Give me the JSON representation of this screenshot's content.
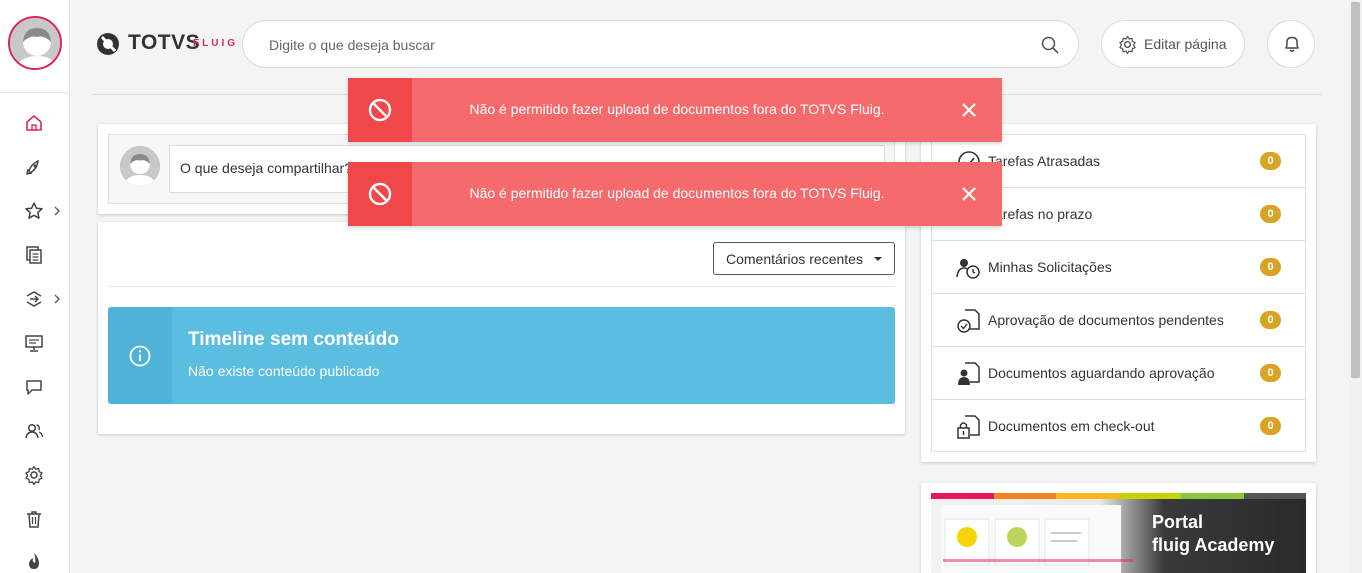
{
  "header": {
    "logo_text": "TOTVS",
    "logo_sub": "FLUIG",
    "search_placeholder": "Digite o que deseja buscar",
    "edit_label": "Editar página"
  },
  "sidebar": {
    "items": [
      {
        "name": "home-icon"
      },
      {
        "name": "rocket-icon"
      },
      {
        "name": "star-icon"
      },
      {
        "name": "documents-icon"
      },
      {
        "name": "workflow-icon"
      },
      {
        "name": "presentation-icon"
      },
      {
        "name": "chat-icon"
      },
      {
        "name": "users-icon"
      },
      {
        "name": "gear-icon"
      },
      {
        "name": "trash-icon"
      },
      {
        "name": "flame-icon"
      }
    ]
  },
  "share": {
    "placeholder": "O que deseja compartilhar?"
  },
  "timeline": {
    "sort_label": "Comentários recentes",
    "empty_title": "Timeline sem conteúdo",
    "empty_text": "Não existe conteúdo publicado"
  },
  "tasks": [
    {
      "label": "Tarefas Atrasadas",
      "count": "0"
    },
    {
      "label": "Tarefas no prazo",
      "count": "0"
    },
    {
      "label": "Minhas Solicitações",
      "count": "0"
    },
    {
      "label": "Aprovação de documentos pendentes",
      "count": "0"
    },
    {
      "label": "Documentos aguardando aprovação",
      "count": "0"
    },
    {
      "label": "Documentos em check-out",
      "count": "0"
    }
  ],
  "academy": {
    "line1": "Portal",
    "line2": "fluig Academy"
  },
  "toasts": [
    {
      "message": "Não é permitido fazer upload de documentos fora do TOTVS Fluig."
    },
    {
      "message": "Não é permitido fazer upload de documentos fora do TOTVS Fluig."
    }
  ],
  "colors": {
    "brand_accent": "#d8285a",
    "toast_bg": "#f46a6d",
    "info_bg": "#5bbde0",
    "badge": "#d8a424"
  }
}
